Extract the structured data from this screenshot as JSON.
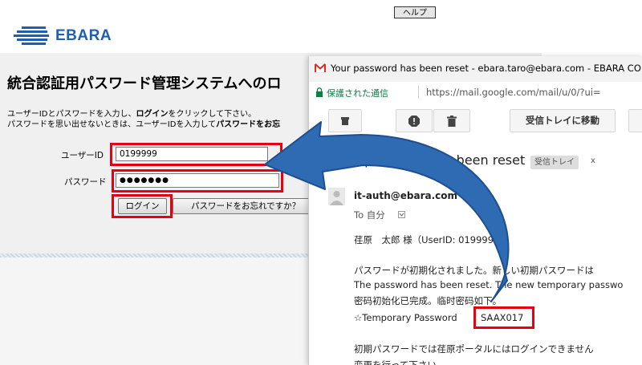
{
  "portal": {
    "help_label": "ヘルプ",
    "logo_text": "EBARA",
    "title": "統合認証用パスワード管理システムへのロ",
    "instruction_1_pre": "ユーザーIDとパスワードを入力し、",
    "instruction_1_bold": "ログイン",
    "instruction_1_post": "をクリックして下さい。",
    "instruction_2_pre": "パスワードを思い出せないときは、ユーザーIDを入力して",
    "instruction_2_bold": "パスワードをお忘",
    "userid_label": "ユーザーID",
    "userid_value": "0199999",
    "password_label": "パスワード",
    "password_value": "●●●●●●●",
    "login_label": "ログイン",
    "forgot_label": "パスワードをお忘れですか？",
    "highlight_color": "#e60012"
  },
  "gmail": {
    "window_title": "Your password has been reset - ebara.taro@ebara.com - EBARA CO",
    "secure_label": "保護された通信",
    "url": "https://mail.google.com/mail/u/0/?ui=",
    "move_to_inbox": "受信トレイに移動",
    "subject": "Your password has been reset",
    "label_inbox": "受信トレイ",
    "label_close": "x",
    "sender": "it-auth@ebara.com",
    "recipient": "To 自分",
    "body": {
      "greeting": "荏原　太郎 様（UserID: 0199999）",
      "line_ja": "パスワードが初期化されました。新しい初期パスワードは",
      "line_en": "The password has been reset. The new temporary passwo",
      "line_zh": "密码初始化已完成。临时密码如下。",
      "temp_label": "☆Temporary Password",
      "temp_value": "SAAX017",
      "line_note": "初期パスワードでは荏原ポータルにはログインできません",
      "line_last": "変更を行って下さい"
    }
  },
  "arrow_color": "#2f6bb3"
}
